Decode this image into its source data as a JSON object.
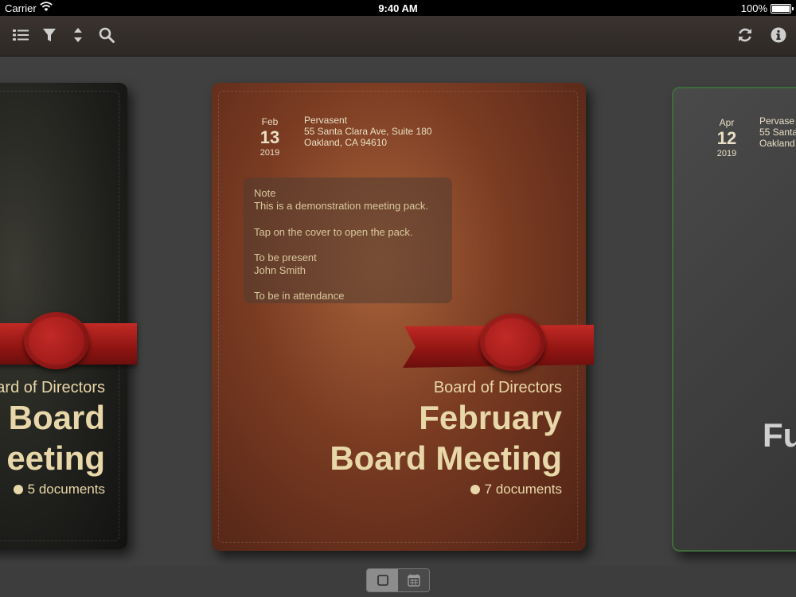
{
  "status_bar": {
    "carrier": "Carrier",
    "time": "9:40 AM",
    "battery": "100%"
  },
  "toolbar": {
    "icons": [
      "list-icon",
      "filter-icon",
      "sort-icon",
      "search-icon",
      "refresh-icon",
      "info-icon"
    ]
  },
  "covers": [
    {
      "subtitle": "ard of Directors",
      "title_line1": "Board",
      "title_line2": "eeting",
      "documents": "5 documents",
      "color": "#1f1f1c"
    },
    {
      "date": {
        "month": "Feb",
        "day": "13",
        "year": "2019"
      },
      "address": {
        "line1": "Pervasent",
        "line2": "55 Santa Clara Ave, Suite 180",
        "line3": "Oakland, CA 94610"
      },
      "note": {
        "heading": "Note",
        "line1": "This is a demonstration meeting pack.",
        "line2": "Tap on the cover to open the pack.",
        "line3": "To be present",
        "line4": "John Smith",
        "line5": "To be in attendance"
      },
      "subtitle": "Board of Directors",
      "title_line1": "February",
      "title_line2": "Board Meeting",
      "documents": "7 documents",
      "color": "#7a3b22"
    },
    {
      "date": {
        "month": "Apr",
        "day": "12",
        "year": "2019"
      },
      "address": {
        "line1": "Pervase",
        "line2": "55 Santa",
        "line3": "Oakland"
      },
      "title_partial": "Fu",
      "color": "#3f6b3a"
    }
  ],
  "view_toggle": {
    "options": [
      "cover-view-icon",
      "calendar-view-icon"
    ],
    "selected": "cover-view-icon"
  }
}
